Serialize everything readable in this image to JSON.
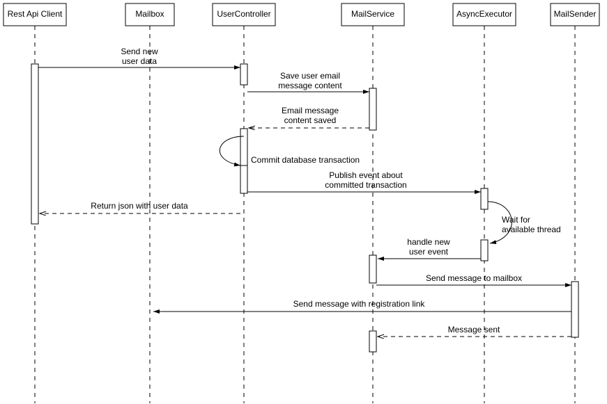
{
  "participants": {
    "rest": {
      "label": "Rest Api Client"
    },
    "mailbox": {
      "label": "Mailbox"
    },
    "uc": {
      "label": "UserController"
    },
    "ms": {
      "label": "MailService"
    },
    "ae": {
      "label": "AsyncExecutor"
    },
    "sender": {
      "label": "MailSender"
    }
  },
  "messages": {
    "sendNewUser": {
      "l1": "Send new",
      "l2": "user data"
    },
    "saveEmail": {
      "l1": "Save user email",
      "l2": "message content"
    },
    "emailSaved": {
      "l1": "Email message",
      "l2": "content saved"
    },
    "commitTx": "Commit database transaction",
    "publishEvent": {
      "l1": "Publish event about",
      "l2": "committed transaction"
    },
    "returnJson": "Return json with user data",
    "waitThread": {
      "l1": "Wait for",
      "l2": "available thread"
    },
    "handleEvent": {
      "l1": "handle new",
      "l2": "user event"
    },
    "sendToMailbox": "Send message to mailbox",
    "sendRegLink": "Send message with registration link",
    "messageSent": "Message sent"
  }
}
